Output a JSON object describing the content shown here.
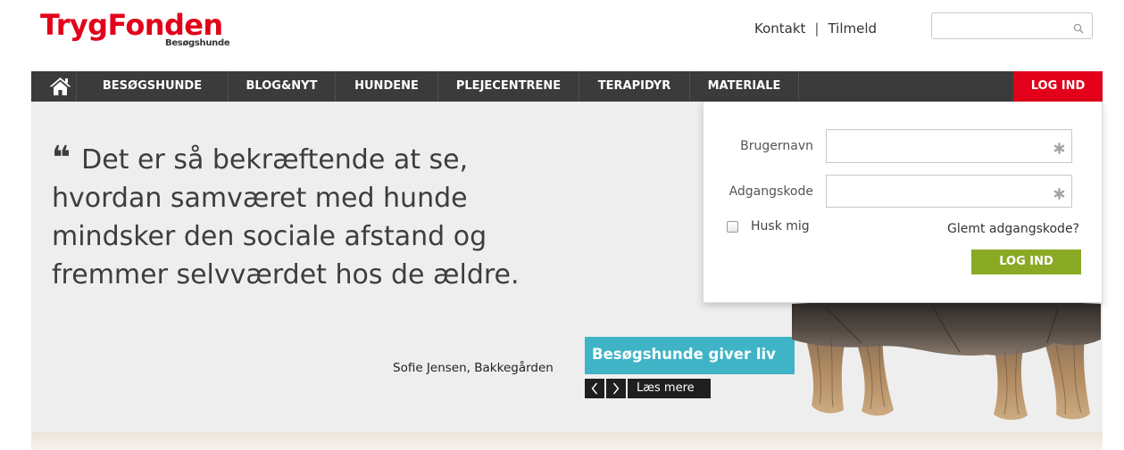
{
  "logo": {
    "brand": "TrygFonden",
    "tagline": "Besøgshunde",
    "brand_color": "#e2001a"
  },
  "header": {
    "links": [
      {
        "label": "Kontakt"
      },
      {
        "label": "Tilmeld"
      }
    ],
    "separator": "|",
    "search": {
      "placeholder": "",
      "icon": "search-icon"
    }
  },
  "nav": {
    "home_icon": "home-icon",
    "items": [
      {
        "label": "BESØGSHUNDE"
      },
      {
        "label": "BLOG&NYT"
      },
      {
        "label": "HUNDENE"
      },
      {
        "label": "PLEJECENTRENE"
      },
      {
        "label": "TERAPIDYR"
      },
      {
        "label": "MATERIALE"
      }
    ],
    "login_label": "LOG IND",
    "login_color": "#e2001a",
    "background": "#3b3b3b"
  },
  "hero": {
    "quote_mark": "❝",
    "quote": "Det er så bekræftende at se, hvordan samværet med hunde mindsker den sociale afstand og fremmer selvværdet hos de ældre.",
    "attribution": "Sofie Jensen, Bakkegården",
    "slide_title": "Besøgshunde giver liv",
    "slide_title_color": "#3fb4c6",
    "prev_icon": "chevron-left-icon",
    "next_icon": "chevron-right-icon",
    "more_label": "Læs mere"
  },
  "login": {
    "username": {
      "label": "Brugernavn",
      "value": "",
      "required_icon": "asterisk-icon"
    },
    "password": {
      "label": "Adgangskode",
      "value": "",
      "required_icon": "asterisk-icon"
    },
    "remember": {
      "label": "Husk mig",
      "checked": false
    },
    "forgot_label": "Glemt adgangskode?",
    "submit_label": "LOG IND",
    "submit_color": "#8aaa26"
  }
}
